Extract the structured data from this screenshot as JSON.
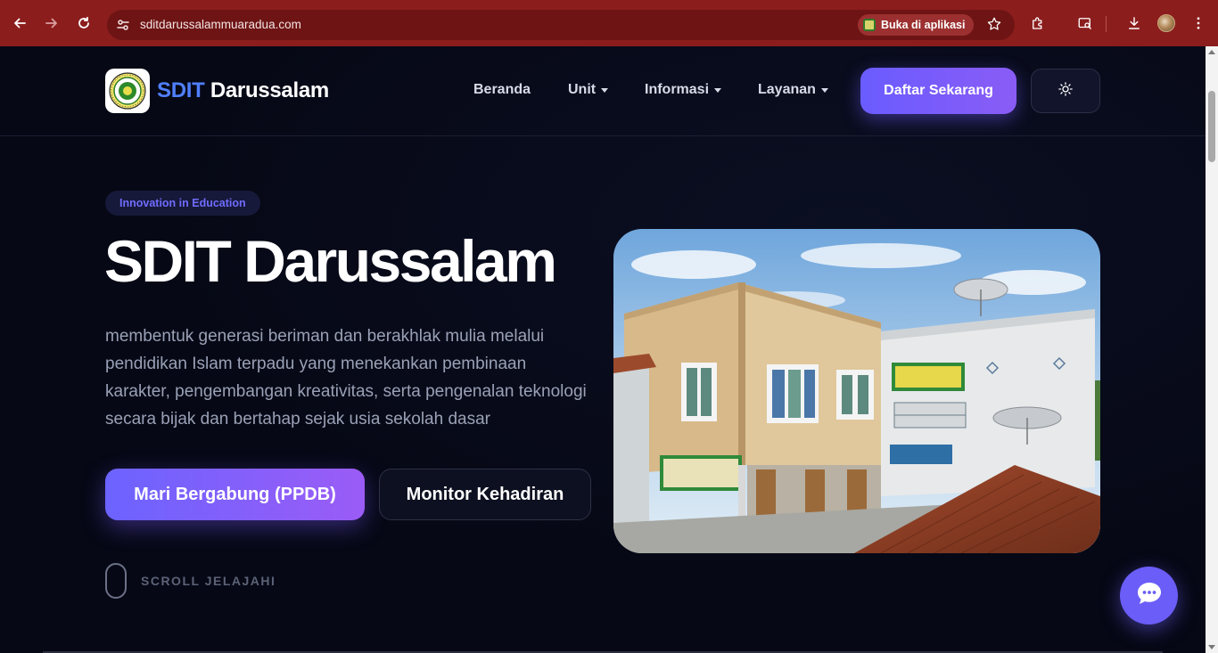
{
  "browser": {
    "url": "sditdarussalammuaradua.com",
    "open_app_label": "Buka di aplikasi",
    "icons": [
      "back-icon",
      "forward-icon",
      "reload-icon",
      "site-info-icon",
      "bookmark-star-icon",
      "extensions-icon",
      "tab-search-icon",
      "download-icon",
      "profile-avatar",
      "more-menu-icon"
    ]
  },
  "site": {
    "brand_part1": "SDIT",
    "brand_part2": "Darussalam",
    "nav": [
      {
        "label": "Beranda",
        "has_caret": false
      },
      {
        "label": "Unit",
        "has_caret": true
      },
      {
        "label": "Informasi",
        "has_caret": true
      },
      {
        "label": "Layanan",
        "has_caret": true
      }
    ],
    "cta_label": "Daftar Sekarang",
    "theme_toggle_icon": "sun-icon"
  },
  "hero": {
    "badge": "Innovation in Education",
    "title": "SDIT Darussalam",
    "description": "membentuk generasi beriman dan berakhlak mulia melalui pendidikan Islam terpadu yang menekankan pembinaan karakter, pengembangan kreativitas, serta pengenalan teknologi secara bijak dan bertahap sejak usia sekolah dasar",
    "primary_button": "Mari Bergabung (PPDB)",
    "secondary_button": "Monitor Kehadiran",
    "scroll_label": "SCROLL JELAJAHI"
  },
  "chat": {
    "icon": "chat-bubble-icon"
  },
  "colors": {
    "chrome_bar": "#8c1d1d",
    "page_bg": "#060815",
    "accent": "#6a5cff",
    "brand_blue": "#4f7fff"
  }
}
